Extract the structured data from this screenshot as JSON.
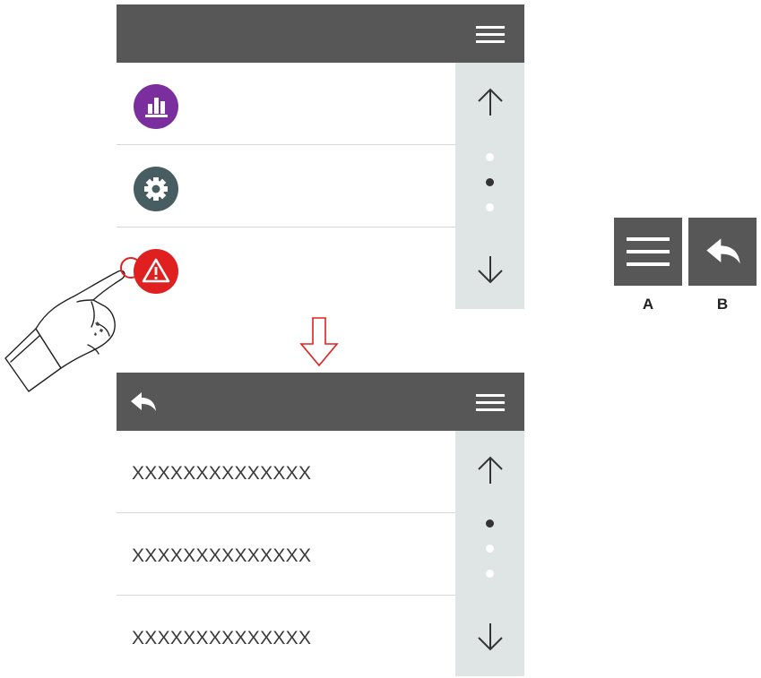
{
  "top_screen": {
    "menu_items": [
      {
        "icon": "bar-chart-icon",
        "color": "#7b2f9e"
      },
      {
        "icon": "gear-icon",
        "color": "#475d61"
      },
      {
        "icon": "warning-icon",
        "color": "#e02020"
      }
    ],
    "pager": {
      "dot_count": 3,
      "active_index": 1
    }
  },
  "bottom_screen": {
    "list_items": [
      {
        "label": "XXXXXXXXXXXXXX"
      },
      {
        "label": "XXXXXXXXXXXXXX"
      },
      {
        "label": "XXXXXXXXXXXXXX"
      }
    ],
    "pager": {
      "dot_count": 3,
      "active_index": 0
    }
  },
  "legend": {
    "a_label": "A",
    "b_label": "B",
    "a_icon": "menu-icon",
    "b_icon": "back-icon"
  },
  "colors": {
    "bar": "#575757",
    "scrollbar": "#dfe5e5",
    "transition_arrow": "#e02020"
  }
}
